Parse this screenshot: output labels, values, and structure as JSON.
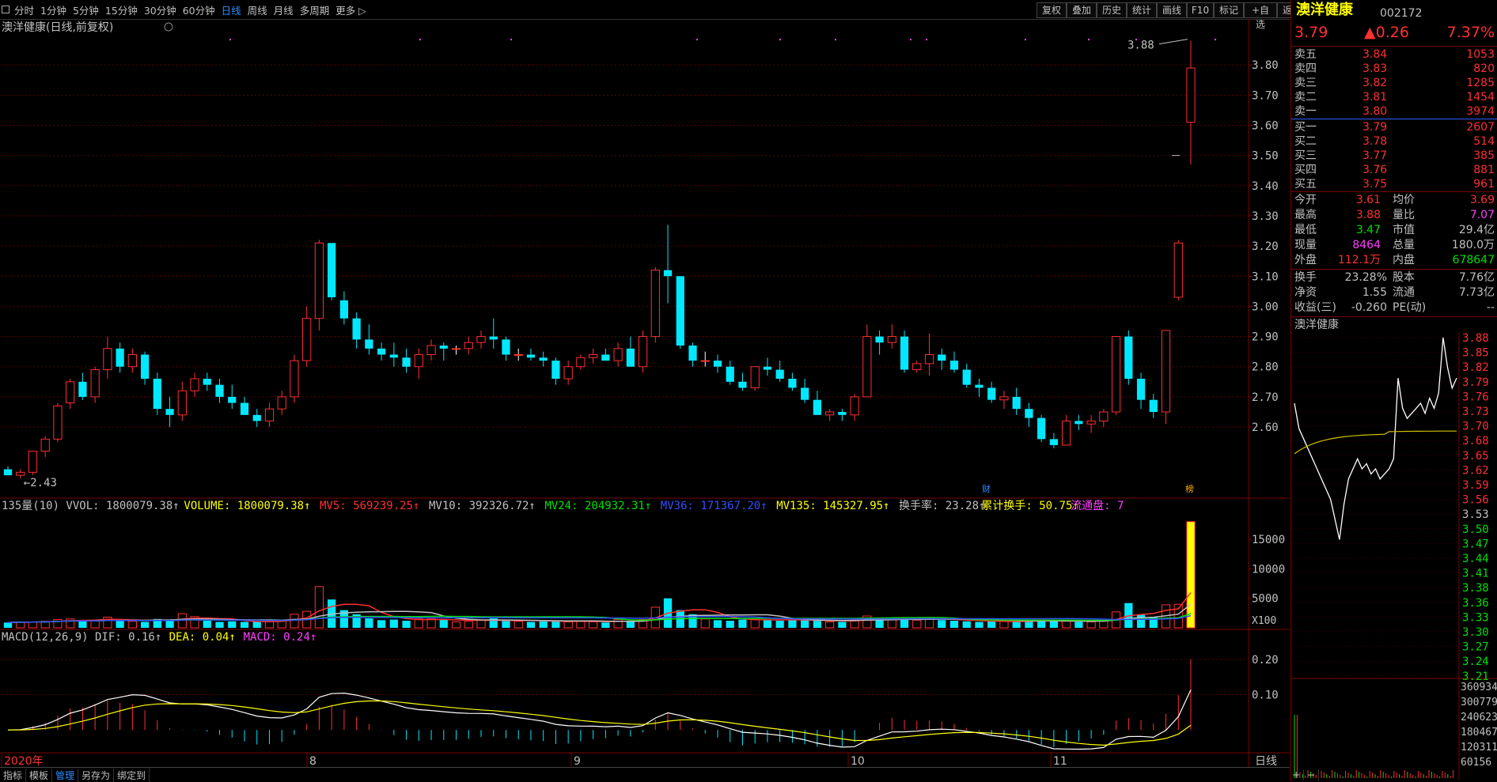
{
  "toolbar": {
    "tabs": [
      "分时",
      "1分钟",
      "5分钟",
      "15分钟",
      "30分钟",
      "60分钟",
      "日线",
      "周线",
      "月线",
      "多周期",
      "更多"
    ],
    "active_tab": "日线",
    "right_buttons": [
      "复权",
      "叠加",
      "历史",
      "统计",
      "画线",
      "F10",
      "标记",
      "+自选",
      "返回"
    ]
  },
  "main_chart": {
    "title": "澳洋健康(日线,前复权)",
    "high_label": "3.88",
    "low_label": "2.43",
    "markers": [
      "财",
      "榜"
    ],
    "ylabels": [
      "3.80",
      "3.70",
      "3.60",
      "3.50",
      "3.40",
      "3.30",
      "3.20",
      "3.10",
      "3.00",
      "2.90",
      "2.80",
      "2.70",
      "2.60"
    ]
  },
  "volume_chart": {
    "legend": [
      {
        "text": "135量(10) VVOL: 1800079.38↑",
        "color": "#c0c0c0"
      },
      {
        "text": "VOLUME: 1800079.38↑",
        "color": "#ffff00"
      },
      {
        "text": "MV5: 569239.25↑",
        "color": "#ff3030"
      },
      {
        "text": "MV10: 392326.72↑",
        "color": "#c0c0c0"
      },
      {
        "text": "MV24: 204932.31↑",
        "color": "#00e000"
      },
      {
        "text": "MV36: 171367.20↑",
        "color": "#3050ff"
      },
      {
        "text": "MV135: 145327.95↑",
        "color": "#ffff00"
      },
      {
        "text": "换手率: 23.28↑",
        "color": "#c0c0c0"
      },
      {
        "text": "累计换手: 50.75↑",
        "color": "#ffff00"
      },
      {
        "text": "流通盘: 7",
        "color": "#ff40ff"
      }
    ],
    "ylabels": [
      "15000",
      "10000",
      "5000"
    ],
    "unit": "X100"
  },
  "macd_chart": {
    "legend": [
      {
        "text": "MACD(12,26,9) DIF: 0.16↑",
        "color": "#c0c0c0"
      },
      {
        "text": "DEA: 0.04↑",
        "color": "#ffff00"
      },
      {
        "text": "MACD: 0.24↑",
        "color": "#ff40ff"
      }
    ],
    "ylabels": [
      "0.20",
      "0.10"
    ]
  },
  "time_axis": {
    "labels": [
      "2020年",
      "8",
      "9",
      "10",
      "11"
    ],
    "period": "日线"
  },
  "chart_data": {
    "type": "candlestick",
    "ylim": [
      2.38,
      3.9
    ],
    "candles": [
      [
        2.46,
        2.47,
        2.44,
        2.44
      ],
      [
        2.44,
        2.46,
        2.43,
        2.45
      ],
      [
        2.45,
        2.52,
        2.44,
        2.52
      ],
      [
        2.52,
        2.57,
        2.5,
        2.56
      ],
      [
        2.56,
        2.68,
        2.55,
        2.67
      ],
      [
        2.68,
        2.76,
        2.66,
        2.75
      ],
      [
        2.75,
        2.78,
        2.69,
        2.7
      ],
      [
        2.7,
        2.8,
        2.68,
        2.79
      ],
      [
        2.79,
        2.9,
        2.76,
        2.86
      ],
      [
        2.86,
        2.88,
        2.78,
        2.8
      ],
      [
        2.8,
        2.86,
        2.78,
        2.84
      ],
      [
        2.84,
        2.85,
        2.74,
        2.76
      ],
      [
        2.76,
        2.78,
        2.64,
        2.66
      ],
      [
        2.66,
        2.7,
        2.6,
        2.64
      ],
      [
        2.64,
        2.75,
        2.62,
        2.72
      ],
      [
        2.72,
        2.78,
        2.7,
        2.76
      ],
      [
        2.76,
        2.78,
        2.72,
        2.74
      ],
      [
        2.74,
        2.76,
        2.68,
        2.7
      ],
      [
        2.7,
        2.74,
        2.66,
        2.68
      ],
      [
        2.68,
        2.7,
        2.64,
        2.64
      ],
      [
        2.64,
        2.66,
        2.6,
        2.62
      ],
      [
        2.62,
        2.68,
        2.6,
        2.66
      ],
      [
        2.66,
        2.72,
        2.64,
        2.7
      ],
      [
        2.7,
        2.84,
        2.68,
        2.82
      ],
      [
        2.82,
        3.0,
        2.8,
        2.96
      ],
      [
        2.96,
        3.22,
        2.92,
        3.21
      ],
      [
        3.21,
        3.21,
        3.02,
        3.03
      ],
      [
        3.02,
        3.05,
        2.94,
        2.96
      ],
      [
        2.96,
        2.98,
        2.86,
        2.89
      ],
      [
        2.89,
        2.94,
        2.84,
        2.86
      ],
      [
        2.86,
        2.88,
        2.82,
        2.84
      ],
      [
        2.84,
        2.88,
        2.8,
        2.83
      ],
      [
        2.83,
        2.86,
        2.78,
        2.8
      ],
      [
        2.8,
        2.86,
        2.76,
        2.84
      ],
      [
        2.84,
        2.89,
        2.82,
        2.87
      ],
      [
        2.87,
        2.88,
        2.82,
        2.86
      ],
      [
        2.86,
        2.87,
        2.84,
        2.86
      ],
      [
        2.86,
        2.9,
        2.84,
        2.88
      ],
      [
        2.88,
        2.92,
        2.86,
        2.9
      ],
      [
        2.9,
        2.96,
        2.86,
        2.89
      ],
      [
        2.89,
        2.9,
        2.82,
        2.84
      ],
      [
        2.84,
        2.86,
        2.82,
        2.84
      ],
      [
        2.84,
        2.86,
        2.82,
        2.83
      ],
      [
        2.83,
        2.85,
        2.8,
        2.82
      ],
      [
        2.82,
        2.83,
        2.74,
        2.76
      ],
      [
        2.76,
        2.82,
        2.74,
        2.8
      ],
      [
        2.8,
        2.84,
        2.79,
        2.83
      ],
      [
        2.83,
        2.86,
        2.81,
        2.84
      ],
      [
        2.84,
        2.86,
        2.82,
        2.82
      ],
      [
        2.82,
        2.88,
        2.8,
        2.86
      ],
      [
        2.86,
        2.9,
        2.8,
        2.8
      ],
      [
        2.8,
        2.92,
        2.78,
        2.9
      ],
      [
        2.9,
        3.13,
        2.88,
        3.12
      ],
      [
        3.12,
        3.27,
        3.01,
        3.1
      ],
      [
        3.1,
        3.08,
        2.86,
        2.87
      ],
      [
        2.87,
        2.88,
        2.8,
        2.82
      ],
      [
        2.82,
        2.85,
        2.8,
        2.82
      ],
      [
        2.82,
        2.84,
        2.78,
        2.8
      ],
      [
        2.8,
        2.82,
        2.74,
        2.75
      ],
      [
        2.75,
        2.78,
        2.72,
        2.73
      ],
      [
        2.73,
        2.8,
        2.72,
        2.8
      ],
      [
        2.8,
        2.83,
        2.77,
        2.79
      ],
      [
        2.79,
        2.82,
        2.75,
        2.76
      ],
      [
        2.76,
        2.78,
        2.72,
        2.73
      ],
      [
        2.73,
        2.76,
        2.68,
        2.69
      ],
      [
        2.69,
        2.72,
        2.64,
        2.64
      ],
      [
        2.64,
        2.66,
        2.62,
        2.65
      ],
      [
        2.65,
        2.66,
        2.62,
        2.64
      ],
      [
        2.64,
        2.71,
        2.62,
        2.7
      ],
      [
        2.7,
        2.94,
        2.7,
        2.9
      ],
      [
        2.9,
        2.92,
        2.84,
        2.88
      ],
      [
        2.88,
        2.94,
        2.86,
        2.9
      ],
      [
        2.9,
        2.92,
        2.78,
        2.79
      ],
      [
        2.79,
        2.82,
        2.78,
        2.81
      ],
      [
        2.81,
        2.91,
        2.77,
        2.84
      ],
      [
        2.84,
        2.86,
        2.79,
        2.82
      ],
      [
        2.82,
        2.85,
        2.78,
        2.79
      ],
      [
        2.79,
        2.81,
        2.73,
        2.74
      ],
      [
        2.74,
        2.76,
        2.7,
        2.73
      ],
      [
        2.73,
        2.75,
        2.68,
        2.69
      ],
      [
        2.69,
        2.72,
        2.66,
        2.7
      ],
      [
        2.7,
        2.73,
        2.64,
        2.66
      ],
      [
        2.66,
        2.68,
        2.6,
        2.63
      ],
      [
        2.63,
        2.64,
        2.55,
        2.56
      ],
      [
        2.56,
        2.58,
        2.53,
        2.54
      ],
      [
        2.54,
        2.64,
        2.54,
        2.62
      ],
      [
        2.62,
        2.64,
        2.59,
        2.61
      ],
      [
        2.61,
        2.64,
        2.58,
        2.62
      ],
      [
        2.62,
        2.66,
        2.6,
        2.65
      ],
      [
        2.65,
        2.9,
        2.64,
        2.9
      ],
      [
        2.9,
        2.92,
        2.74,
        2.76
      ],
      [
        2.76,
        2.78,
        2.66,
        2.69
      ],
      [
        2.69,
        2.71,
        2.63,
        2.65
      ],
      [
        2.65,
        2.92,
        2.61,
        2.92
      ],
      [
        3.03,
        3.22,
        3.02,
        3.21
      ],
      [
        3.61,
        3.88,
        3.47,
        3.79
      ]
    ],
    "volume": [
      0.9,
      1.0,
      1.0,
      1.1,
      1.4,
      1.5,
      1.3,
      1.2,
      1.8,
      1.3,
      1.1,
      1.0,
      1.5,
      1.3,
      2.4,
      1.9,
      1.2,
      1.0,
      1.1,
      1.0,
      1.0,
      1.1,
      1.2,
      2.3,
      2.8,
      7.0,
      4.8,
      3.0,
      2.3,
      1.6,
      1.3,
      1.4,
      1.2,
      1.5,
      1.6,
      1.4,
      1.0,
      1.1,
      1.3,
      1.6,
      1.2,
      1.1,
      1.0,
      1.1,
      1.2,
      1.0,
      1.1,
      1.0,
      0.9,
      1.4,
      1.2,
      1.4,
      3.5,
      5.0,
      3.0,
      2.3,
      1.5,
      1.3,
      1.2,
      1.4,
      1.5,
      1.4,
      1.2,
      1.3,
      1.3,
      1.2,
      1.0,
      1.0,
      1.3,
      2.0,
      1.7,
      1.6,
      1.8,
      1.3,
      1.6,
      1.3,
      1.2,
      1.1,
      1.0,
      1.1,
      1.1,
      1.0,
      1.2,
      1.4,
      1.2,
      1.2,
      1.0,
      1.0,
      1.2,
      2.7,
      4.2,
      2.2,
      1.8,
      3.9,
      4.0,
      18.0
    ],
    "macd_range": [
      -0.06,
      0.24
    ]
  },
  "quote": {
    "name": "澳洋健康",
    "code": "002172",
    "price": "3.79",
    "change": "▲0.26",
    "pct": "7.37%",
    "asks": [
      {
        "label": "卖五",
        "price": "3.84",
        "vol": "1053"
      },
      {
        "label": "卖四",
        "price": "3.83",
        "vol": "820"
      },
      {
        "label": "卖三",
        "price": "3.82",
        "vol": "1285"
      },
      {
        "label": "卖二",
        "price": "3.81",
        "vol": "1454"
      },
      {
        "label": "卖一",
        "price": "3.80",
        "vol": "3974"
      }
    ],
    "bids": [
      {
        "label": "买一",
        "price": "3.79",
        "vol": "2607"
      },
      {
        "label": "买二",
        "price": "3.78",
        "vol": "514"
      },
      {
        "label": "买三",
        "price": "3.77",
        "vol": "385"
      },
      {
        "label": "买四",
        "price": "3.76",
        "vol": "881"
      },
      {
        "label": "买五",
        "price": "3.75",
        "vol": "961"
      }
    ],
    "stats": [
      {
        "l1": "今开",
        "v1": "3.61",
        "c1": "up",
        "l2": "均价",
        "v2": "3.69",
        "c2": "up"
      },
      {
        "l1": "最高",
        "v1": "3.88",
        "c1": "up",
        "l2": "量比",
        "v2": "7.07",
        "c2": "mg"
      },
      {
        "l1": "最低",
        "v1": "3.47",
        "c1": "down",
        "l2": "市值",
        "v2": "29.4亿",
        "c2": "wh"
      },
      {
        "l1": "现量",
        "v1": "8464",
        "c1": "mg",
        "l2": "总量",
        "v2": "180.0万",
        "c2": "wh"
      },
      {
        "l1": "外盘",
        "v1": "112.1万",
        "c1": "up",
        "l2": "内盘",
        "v2": "678647",
        "c2": "down"
      }
    ],
    "stats2": [
      {
        "l1": "换手",
        "v1": "23.28%",
        "l2": "股本",
        "v2": "7.76亿"
      },
      {
        "l1": "净资",
        "v1": "1.55",
        "l2": "流通",
        "v2": "7.73亿"
      },
      {
        "l1": "收益(三)",
        "v1": "-0.260",
        "l2": "PE(动)",
        "v2": "--"
      }
    ]
  },
  "mini_chart": {
    "title": "澳洋健康",
    "price_labels": [
      "3.88",
      "3.85",
      "3.82",
      "3.79",
      "3.76",
      "3.73",
      "3.70",
      "3.68",
      "3.65",
      "3.62",
      "3.59",
      "3.56",
      "3.53",
      "3.50",
      "3.47",
      "3.44",
      "3.41",
      "3.38",
      "3.36",
      "3.33",
      "3.30",
      "3.27",
      "3.24",
      "3.21"
    ],
    "vol_labels": [
      "360934",
      "300779",
      "240623",
      "180467",
      "120311",
      "60156"
    ]
  },
  "bottom_tabs": [
    "指标",
    "模板",
    "管理",
    "另存为",
    "绑定到"
  ],
  "bottom_active": "管理"
}
